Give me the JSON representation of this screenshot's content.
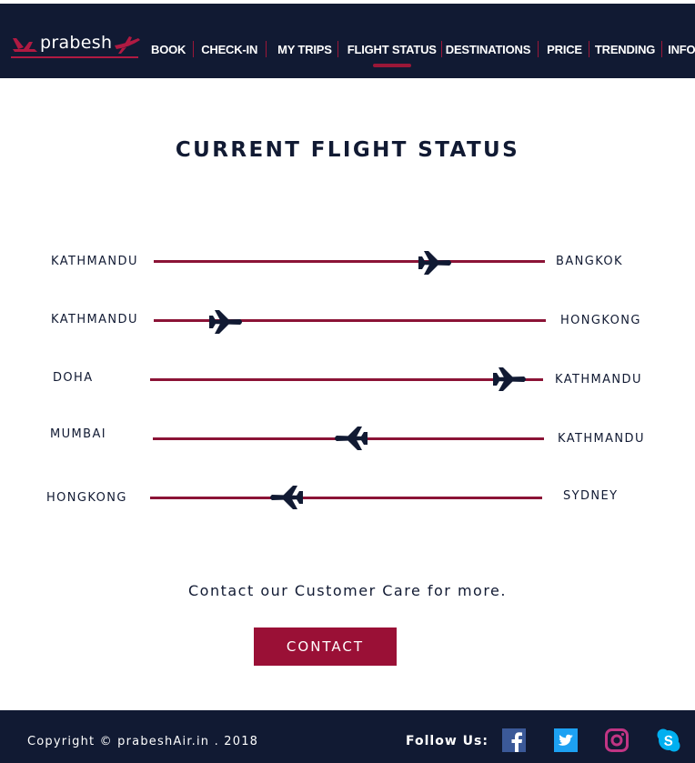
{
  "brand": {
    "name": "prabesh",
    "accent": "#9a1036",
    "navy": "#111a33"
  },
  "nav": {
    "items": [
      "BOOK",
      "CHECK-IN",
      "MY TRIPS",
      "FLIGHT STATUS",
      "DESTINATIONS",
      "PRICE",
      "TRENDING",
      "INFO"
    ],
    "active": "FLIGHT STATUS"
  },
  "main": {
    "title": "CURRENT FLIGHT STATUS",
    "routes": [
      {
        "from": "KATHMANDU",
        "to": "BANGKOK",
        "progress": 0.7,
        "direction": "right"
      },
      {
        "from": "KATHMANDU",
        "to": "HONGKONG",
        "progress": 0.18,
        "direction": "right"
      },
      {
        "from": "DOHA",
        "to": "KATHMANDU",
        "progress": 0.91,
        "direction": "right"
      },
      {
        "from": "MUMBAI",
        "to": "KATHMANDU",
        "progress": 0.5,
        "direction": "left"
      },
      {
        "from": "HONGKONG",
        "to": "SYDNEY",
        "progress": 0.35,
        "direction": "left"
      }
    ],
    "contact_text": "Contact our Customer Care for more.",
    "contact_button": "CONTACT"
  },
  "footer": {
    "copyright": "Copyright © prabeshAir.in . 2018",
    "follow_label": "Follow Us:",
    "social": [
      {
        "name": "facebook-icon",
        "color": "#3b5998"
      },
      {
        "name": "twitter-icon",
        "color": "#1da1f2"
      },
      {
        "name": "instagram-icon",
        "color": "#c13584"
      },
      {
        "name": "skype-icon",
        "color": "#00aff0"
      }
    ]
  }
}
